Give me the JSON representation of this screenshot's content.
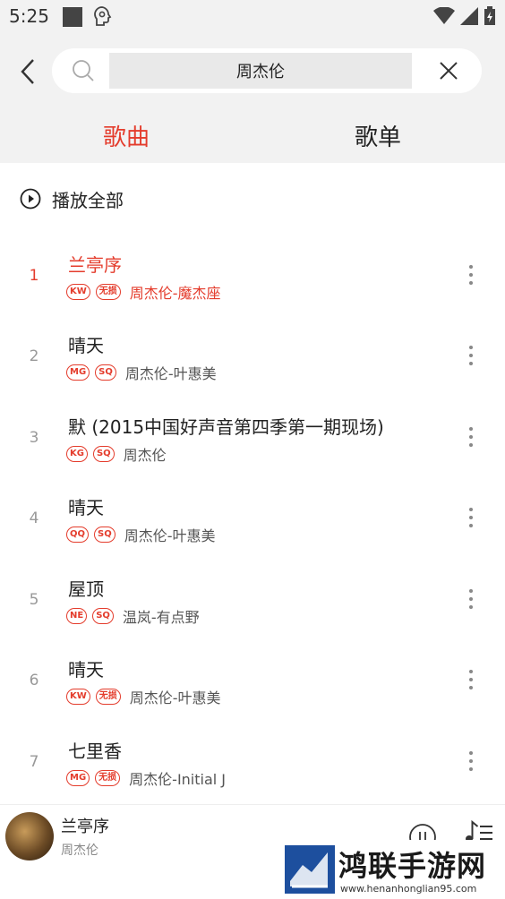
{
  "status_bar": {
    "time": "5:25"
  },
  "search": {
    "query": "周杰伦"
  },
  "tabs": [
    {
      "label": "歌曲",
      "active": true
    },
    {
      "label": "歌单",
      "active": false
    }
  ],
  "play_all": {
    "label": "播放全部"
  },
  "songs": [
    {
      "index": "1",
      "title": "兰亭序",
      "badges": [
        "KW",
        "无损"
      ],
      "artist": "周杰伦-魔杰座",
      "active": true
    },
    {
      "index": "2",
      "title": "晴天",
      "badges": [
        "MG",
        "SQ"
      ],
      "artist": "周杰伦-叶惠美",
      "active": false
    },
    {
      "index": "3",
      "title": "默 (2015中国好声音第四季第一期现场)",
      "badges": [
        "KG",
        "SQ"
      ],
      "artist": "周杰伦",
      "active": false
    },
    {
      "index": "4",
      "title": "晴天",
      "badges": [
        "QQ",
        "SQ"
      ],
      "artist": "周杰伦-叶惠美",
      "active": false
    },
    {
      "index": "5",
      "title": "屋顶",
      "badges": [
        "NE",
        "SQ"
      ],
      "artist": "温岚-有点野",
      "active": false
    },
    {
      "index": "6",
      "title": "晴天",
      "badges": [
        "KW",
        "无损"
      ],
      "artist": "周杰伦-叶惠美",
      "active": false
    },
    {
      "index": "7",
      "title": "七里香",
      "badges": [
        "MG",
        "无损"
      ],
      "artist": "周杰伦-Initial J",
      "active": false
    }
  ],
  "player": {
    "title": "兰亭序",
    "artist": "周杰伦"
  },
  "watermark": {
    "text": "鸿联手游网",
    "url": "www.henanhonglian95.com"
  },
  "colors": {
    "accent": "#e43c2c",
    "header_bg": "#f2f2f2",
    "text": "#222222"
  }
}
